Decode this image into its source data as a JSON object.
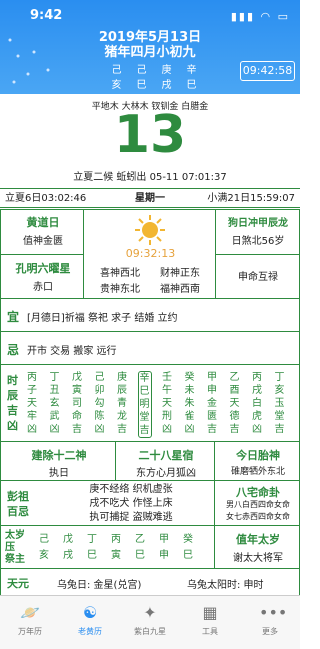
{
  "status_bar": {
    "time": "9:42",
    "icons": "▮▮▮ ◠ ▭"
  },
  "header": {
    "solar_date": "2019年5月13日",
    "lunar_date": "猪年四月小初九",
    "pillars_top": [
      "己",
      "己",
      "庚",
      "辛"
    ],
    "pillars_bottom": [
      "亥",
      "巳",
      "戌",
      "巳"
    ],
    "clock": "09:42:58"
  },
  "day": {
    "nayin": "平地木 大林木 钗钏金 白腊金",
    "day_number": "13",
    "jieqi_line": "立夏二候  蚯蚓出 05-11 07:01:37"
  },
  "terms": {
    "left": "立夏6日03:02:46",
    "center": "星期一",
    "right": "小满21日15:59:07"
  },
  "boxes": {
    "huangdao_title": "黄道日",
    "huangdao_value": "值神金匮",
    "kongming_title": "孔明六曜星",
    "kongming_value": "赤口",
    "clock_time": "09:32:13",
    "gods": [
      "喜神西北",
      "财神正东",
      "贵神东北",
      "福神西南"
    ],
    "chong_title": "狗日冲甲辰龙",
    "chong_value": "日煞北56岁",
    "xinghe": "申命互禄"
  },
  "yi": {
    "label": "宜",
    "text": "[月德日]祈福 祭祀 求子 结婚 立约"
  },
  "ji": {
    "label": "忌",
    "text": "开市 交易 搬家 远行"
  },
  "shichen": {
    "label": [
      "时",
      "辰",
      "吉",
      "凶"
    ],
    "columns": [
      [
        "丙",
        "子",
        "天",
        "牢",
        "凶"
      ],
      [
        "丁",
        "丑",
        "玄",
        "武",
        "凶"
      ],
      [
        "戊",
        "寅",
        "司",
        "命",
        "吉"
      ],
      [
        "己",
        "卯",
        "勾",
        "陈",
        "凶"
      ],
      [
        "庚",
        "辰",
        "青",
        "龙",
        "吉"
      ],
      [
        "辛",
        "巳",
        "明",
        "堂",
        "吉"
      ],
      [
        "壬",
        "午",
        "天",
        "刑",
        "凶"
      ],
      [
        "癸",
        "未",
        "朱",
        "雀",
        "凶"
      ],
      [
        "甲",
        "申",
        "金",
        "匮",
        "吉"
      ],
      [
        "乙",
        "酉",
        "天",
        "德",
        "吉"
      ],
      [
        "丙",
        "戌",
        "白",
        "虎",
        "凶"
      ],
      [
        "丁",
        "亥",
        "玉",
        "堂",
        "吉"
      ]
    ]
  },
  "mid": {
    "jianchu_title": "建除十二神",
    "jianchu_value": "执日",
    "xiu_title": "二十八星宿",
    "xiu_value": "东方心月狐凶",
    "taishen_title": "今日胎神",
    "taishen_value": "碓磨牺外东北"
  },
  "pengzu": {
    "label": [
      "彭祖",
      "百忌"
    ],
    "lines": [
      "庚不经络  织机虚张",
      "戌不吃犬  作怪上床",
      "执可捕捉  盗贼难逃"
    ],
    "bazhai_title": "八宅命卦",
    "bazhai_lines": [
      "男八白西四命女命",
      "女七赤西四命女命"
    ]
  },
  "taisui": {
    "label": [
      "太",
      "岁",
      "压",
      "祭",
      "主"
    ],
    "row1": [
      "己",
      "戊",
      "丁",
      "丙",
      "乙",
      "甲",
      "癸"
    ],
    "row2": [
      "亥",
      "戌",
      "巳",
      "寅",
      "巳",
      "申",
      "巳"
    ],
    "title": "值年太岁",
    "value": "谢太大将军"
  },
  "tianyuan": {
    "label": "天元",
    "left": "乌兔日: 金星(兑宫)",
    "right": "乌兔太阳时: 申时"
  },
  "tabs": [
    {
      "label": "万年历",
      "icon": "🪐"
    },
    {
      "label": "老黄历",
      "icon": "☯"
    },
    {
      "label": "紫白九星",
      "icon": "✦"
    },
    {
      "label": "工具",
      "icon": "▦"
    },
    {
      "label": "更多",
      "icon": "•••"
    }
  ],
  "colors": {
    "header": "#2a8ef0",
    "accent": "#2e8b3f",
    "clock": "#e6a23c"
  }
}
